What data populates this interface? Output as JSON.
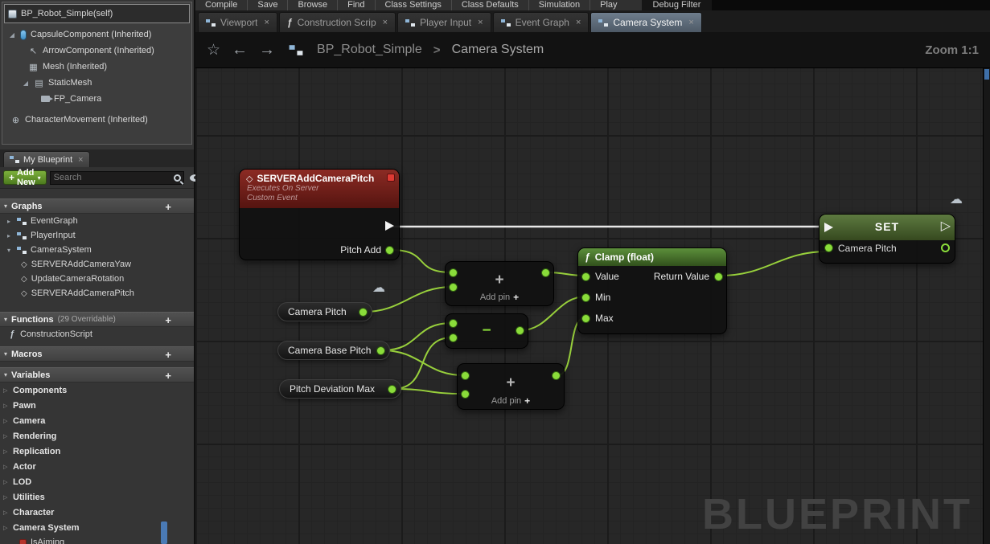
{
  "toolbar": {
    "items": [
      "Compile",
      "Save",
      "Browse",
      "Find",
      "Class Settings",
      "Class Defaults",
      "Simulation",
      "Play",
      "Debug Filter"
    ]
  },
  "components_panel": {
    "rows": [
      {
        "label": "BP_Robot_Simple(self)"
      },
      {
        "label": "CapsuleComponent (Inherited)"
      },
      {
        "label": "ArrowComponent (Inherited)"
      },
      {
        "label": "Mesh (Inherited)"
      },
      {
        "label": "StaticMesh"
      },
      {
        "label": "FP_Camera"
      },
      {
        "label": "CharacterMovement (Inherited)"
      }
    ]
  },
  "my_blueprint": {
    "tab_label": "My Blueprint",
    "add_new_label": "Add New",
    "search_placeholder": "Search",
    "graphs_header": "Graphs",
    "functions_header": "Functions",
    "functions_suffix": "(29 Overridable)",
    "macros_header": "Macros",
    "variables_header": "Variables",
    "graphs": [
      "EventGraph",
      "PlayerInput",
      "CameraSystem"
    ],
    "camera_system_children": [
      "SERVERAddCameraYaw",
      "UpdateCameraRotation",
      "SERVERAddCameraPitch"
    ],
    "functions": [
      "ConstructionScript"
    ],
    "variable_categories": [
      "Components",
      "Pawn",
      "Camera",
      "Rendering",
      "Replication",
      "Actor",
      "LOD",
      "Utilities",
      "Character",
      "Camera System"
    ],
    "partial_variable": "IsAiming"
  },
  "doc_tabs": [
    {
      "label": "Viewport"
    },
    {
      "label": "Construction Scrip"
    },
    {
      "label": "Player Input"
    },
    {
      "label": "Event Graph"
    },
    {
      "label": "Camera System"
    }
  ],
  "graph_header": {
    "root": "BP_Robot_Simple",
    "separator": ">",
    "current": "Camera System",
    "zoom": "Zoom 1:1"
  },
  "watermark": "BLUEPRINT",
  "nodes": {
    "event": {
      "title": "SERVERAddCameraPitch",
      "subtitle1": "Executes On Server",
      "subtitle2": "Custom Event",
      "output_pin": "Pitch Add"
    },
    "getter_camera_pitch": "Camera Pitch",
    "getter_camera_base_pitch": "Camera Base Pitch",
    "getter_pitch_deviation_max": "Pitch Deviation Max",
    "add_symbol": "+",
    "subtract_symbol": "−",
    "add_pin_label": "Add pin",
    "clamp": {
      "title": "Clamp (float)",
      "value": "Value",
      "min": "Min",
      "max": "Max",
      "return": "Return Value"
    },
    "set": {
      "title": "SET",
      "pin": "Camera Pitch"
    }
  },
  "icons": {
    "close": "×",
    "star": "☆",
    "back": "←",
    "forward": "→",
    "plus": "+",
    "caret": "▾",
    "cloud": "☁",
    "diamond": "◇",
    "exec_hollow": "▷",
    "tri_expanded": "◢",
    "tri_collapsed": "▸",
    "cat_collapsed": "▷",
    "fn": "ƒ",
    "arrow_nw": "↖",
    "mesh": "▦",
    "static_mesh": "▤",
    "movement": "⊕",
    "section_caret": "▾"
  },
  "colors": {
    "wire_exec": "#e8e8e8",
    "wire_data": "#a2df3e",
    "pin_green": "#8adc3a",
    "event_header_red": "#8c2b24",
    "function_header_green": "#5c8f3b",
    "add_new_green": "#5d902c",
    "active_tab_blue_gray": "#5d6c7b"
  }
}
